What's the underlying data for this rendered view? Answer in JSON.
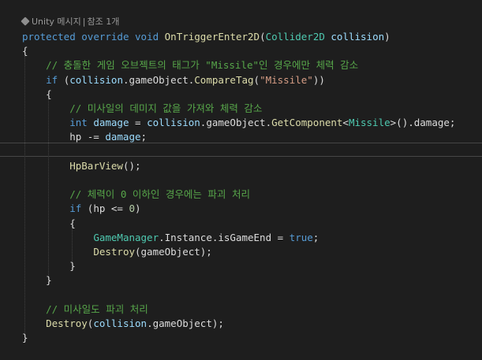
{
  "codelens": {
    "unity_label": "Unity 메시지",
    "separator": "|",
    "references": "참조 1개"
  },
  "colors": {
    "background": "#1e1e1e",
    "keyword": "#569cd6",
    "type": "#4ec9b0",
    "method": "#dcdcaa",
    "parameter": "#9cdcfe",
    "string": "#d69d85",
    "comment": "#57a64a",
    "number": "#b5cea8",
    "plain": "#dcdcdc"
  },
  "code": {
    "lines": [
      [
        [
          "kw",
          "protected"
        ],
        [
          "pl",
          " "
        ],
        [
          "kw",
          "override"
        ],
        [
          "pl",
          " "
        ],
        [
          "kw",
          "void"
        ],
        [
          "pl",
          " "
        ],
        [
          "fn",
          "OnTriggerEnter2D"
        ],
        [
          "pl",
          "("
        ],
        [
          "ty",
          "Collider2D"
        ],
        [
          "pl",
          " "
        ],
        [
          "pm",
          "collision"
        ],
        [
          "pl",
          ")"
        ]
      ],
      [
        [
          "pl",
          "{"
        ]
      ],
      [
        [
          "pl",
          "    "
        ],
        [
          "cm",
          "// 충돌한 게임 오브젝트의 태그가 \"Missile\"인 경우에만 체력 감소"
        ]
      ],
      [
        [
          "pl",
          "    "
        ],
        [
          "kw",
          "if"
        ],
        [
          "pl",
          " ("
        ],
        [
          "pm",
          "collision"
        ],
        [
          "pl",
          ".gameObject."
        ],
        [
          "fn",
          "CompareTag"
        ],
        [
          "pl",
          "("
        ],
        [
          "st",
          "\"Missile\""
        ],
        [
          "pl",
          "))"
        ]
      ],
      [
        [
          "pl",
          "    {"
        ]
      ],
      [
        [
          "pl",
          "        "
        ],
        [
          "cm",
          "// 미사일의 데미지 값을 가져와 체력 감소"
        ]
      ],
      [
        [
          "pl",
          "        "
        ],
        [
          "kw",
          "int"
        ],
        [
          "pl",
          " "
        ],
        [
          "pm",
          "damage"
        ],
        [
          "pl",
          " = "
        ],
        [
          "pm",
          "collision"
        ],
        [
          "pl",
          ".gameObject."
        ],
        [
          "fn",
          "GetComponent"
        ],
        [
          "pl",
          "<"
        ],
        [
          "ty",
          "Missile"
        ],
        [
          "pl",
          ">().damage;"
        ]
      ],
      [
        [
          "pl",
          "        hp -= "
        ],
        [
          "pm",
          "damage"
        ],
        [
          "pl",
          ";"
        ]
      ],
      [
        [
          "pl",
          ""
        ]
      ],
      [
        [
          "pl",
          "        "
        ],
        [
          "fn",
          "HpBarView"
        ],
        [
          "pl",
          "();"
        ]
      ],
      [
        [
          "pl",
          ""
        ]
      ],
      [
        [
          "pl",
          "        "
        ],
        [
          "cm",
          "// 체력이 0 이하인 경우에는 파괴 처리"
        ]
      ],
      [
        [
          "pl",
          "        "
        ],
        [
          "kw",
          "if"
        ],
        [
          "pl",
          " (hp <= "
        ],
        [
          "nu",
          "0"
        ],
        [
          "pl",
          ")"
        ]
      ],
      [
        [
          "pl",
          "        {"
        ]
      ],
      [
        [
          "pl",
          "            "
        ],
        [
          "ty",
          "GameManager"
        ],
        [
          "pl",
          ".Instance.isGameEnd = "
        ],
        [
          "kw",
          "true"
        ],
        [
          "pl",
          ";"
        ]
      ],
      [
        [
          "pl",
          "            "
        ],
        [
          "fn",
          "Destroy"
        ],
        [
          "pl",
          "(gameObject);"
        ]
      ],
      [
        [
          "pl",
          "        }"
        ]
      ],
      [
        [
          "pl",
          "    }"
        ]
      ],
      [
        [
          "pl",
          ""
        ]
      ],
      [
        [
          "pl",
          "    "
        ],
        [
          "cm",
          "// 미사일도 파괴 처리"
        ]
      ],
      [
        [
          "pl",
          "    "
        ],
        [
          "fn",
          "Destroy"
        ],
        [
          "pl",
          "("
        ],
        [
          "pm",
          "collision"
        ],
        [
          "pl",
          ".gameObject);"
        ]
      ],
      [
        [
          "pl",
          "}"
        ]
      ]
    ]
  }
}
